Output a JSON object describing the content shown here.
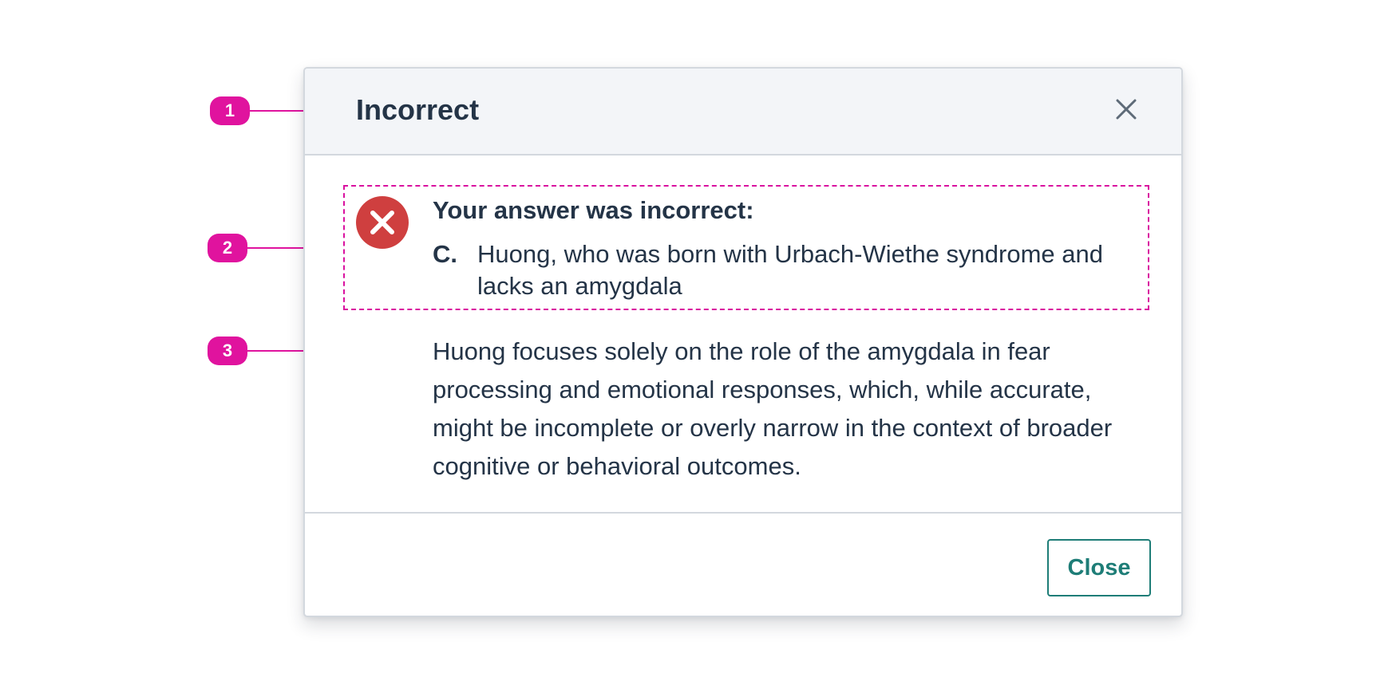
{
  "modal": {
    "title": "Incorrect",
    "close_icon": "close-icon",
    "result_icon": "error-x-icon",
    "answer_heading": "Your answer was incorrect:",
    "selected_option": {
      "letter": "C.",
      "text": "Huong, who was born with Urbach-Wiethe syndrome and lacks an amygdala"
    },
    "explanation": "Huong focuses solely on the role of the amygdala in fear processing and emotional responses, which, while accurate, might be incomplete or overly narrow in the context of broader cognitive or behavioral outcomes.",
    "close_button_label": "Close"
  },
  "callouts": [
    "1",
    "2",
    "3"
  ],
  "colors": {
    "header_bg": "#f3f5f8",
    "text": "#243447",
    "error": "#cf3f3f",
    "accent": "#1e7d77",
    "annotation": "#e0139e"
  }
}
